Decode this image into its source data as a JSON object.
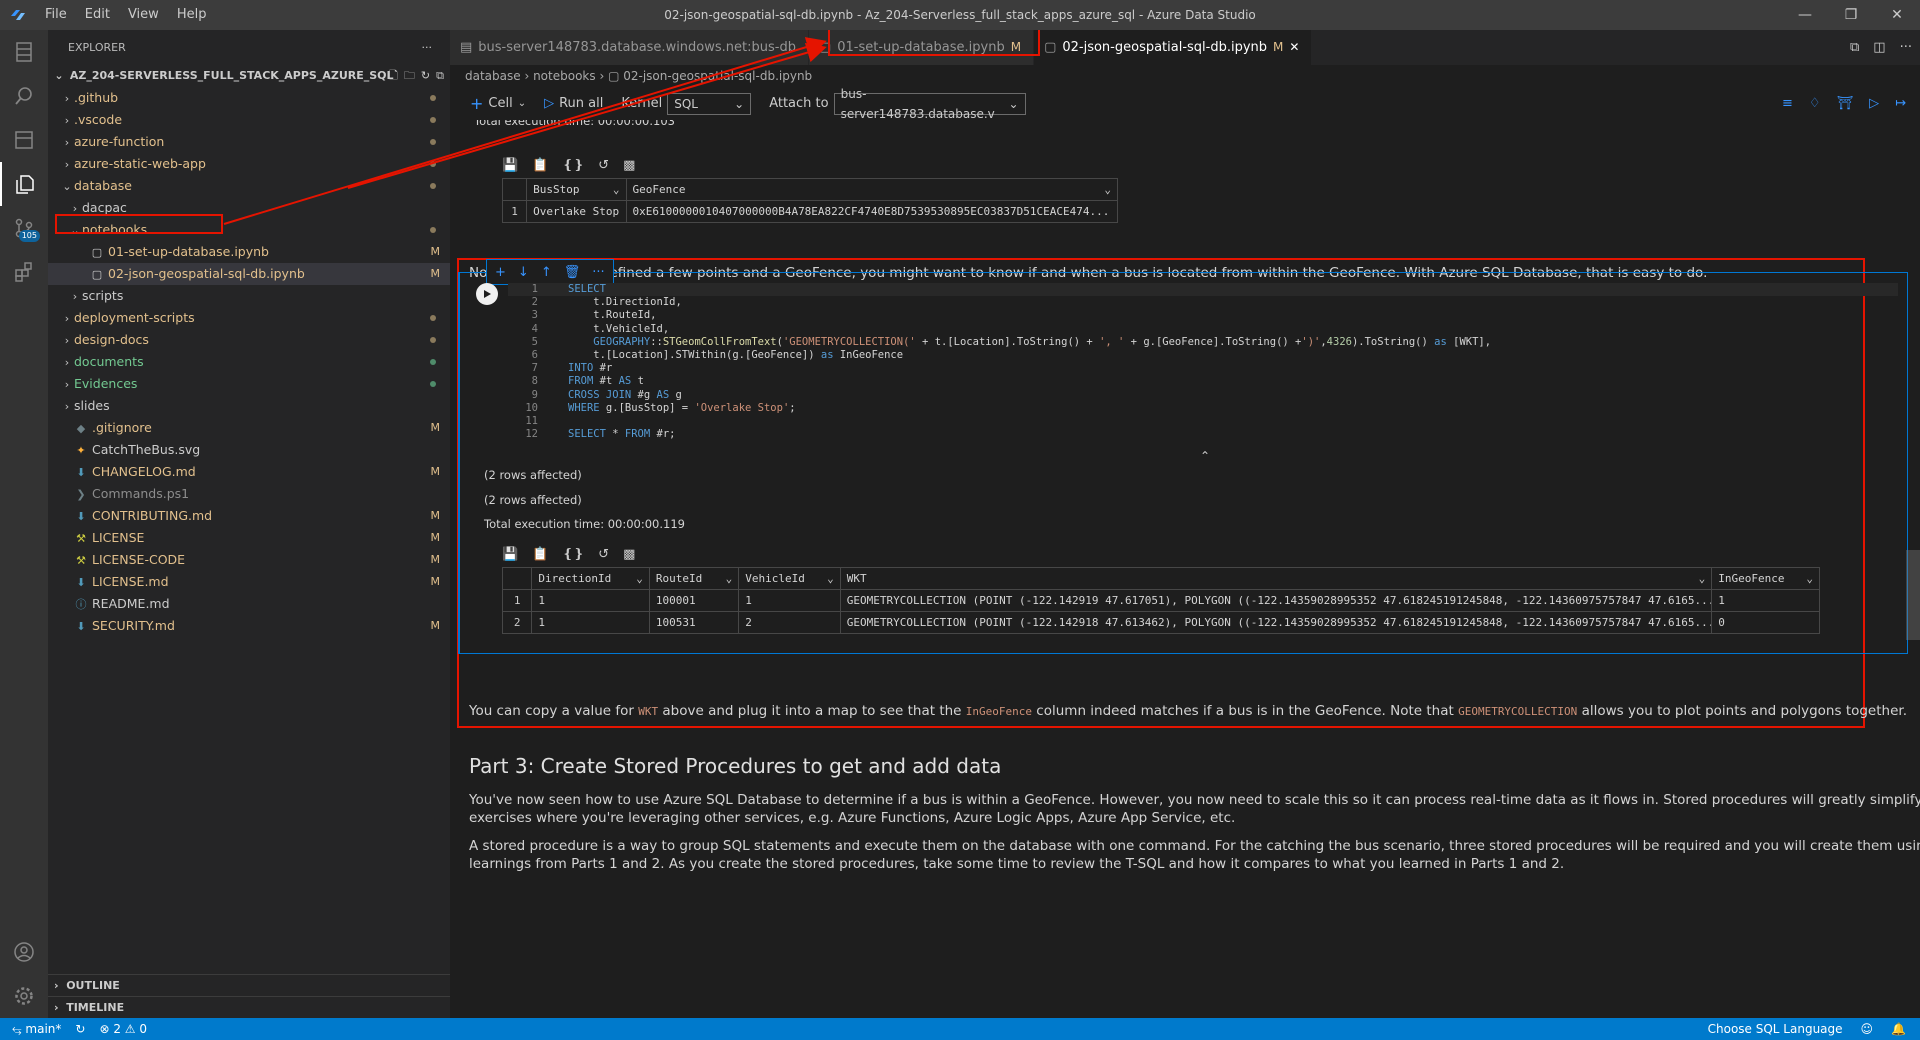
{
  "window": {
    "title": "02-json-geospatial-sql-db.ipynb - Az_204-Serverless_full_stack_apps_azure_sql - Azure Data Studio",
    "menu": [
      "File",
      "Edit",
      "View",
      "Help"
    ]
  },
  "activity": {
    "scm_badge": "105"
  },
  "explorer": {
    "header": "EXPLORER",
    "root": "AZ_204-SERVERLESS_FULL_STACK_APPS_AZURE_SQL",
    "items": [
      {
        "label": ".github",
        "type": "folder",
        "state": "collapsed",
        "indent": 0,
        "status": "dot-mod"
      },
      {
        "label": ".vscode",
        "type": "folder",
        "state": "collapsed",
        "indent": 0,
        "status": "dot-mod"
      },
      {
        "label": "azure-function",
        "type": "folder",
        "state": "collapsed",
        "indent": 0,
        "status": "dot-mod"
      },
      {
        "label": "azure-static-web-app",
        "type": "folder",
        "state": "collapsed",
        "indent": 0,
        "status": "dot-mod"
      },
      {
        "label": "database",
        "type": "folder",
        "state": "expanded",
        "indent": 0,
        "status": "dot-mod"
      },
      {
        "label": "dacpac",
        "type": "folder",
        "state": "collapsed",
        "indent": 1,
        "status": ""
      },
      {
        "label": "notebooks",
        "type": "folder",
        "state": "expanded",
        "indent": 1,
        "status": "dot-mod"
      },
      {
        "label": "01-set-up-database.ipynb",
        "type": "notebook",
        "state": "",
        "indent": 2,
        "status": "M"
      },
      {
        "label": "02-json-geospatial-sql-db.ipynb",
        "type": "notebook",
        "state": "",
        "indent": 2,
        "status": "M",
        "selected": true
      },
      {
        "label": "scripts",
        "type": "folder",
        "state": "collapsed",
        "indent": 1,
        "status": ""
      },
      {
        "label": "deployment-scripts",
        "type": "folder",
        "state": "collapsed",
        "indent": 0,
        "status": "dot-mod"
      },
      {
        "label": "design-docs",
        "type": "folder",
        "state": "collapsed",
        "indent": 0,
        "status": "dot-mod"
      },
      {
        "label": "documents",
        "type": "folder",
        "state": "collapsed",
        "indent": 0,
        "status": "dot-new"
      },
      {
        "label": "Evidences",
        "type": "folder",
        "state": "collapsed",
        "indent": 0,
        "status": "dot-new"
      },
      {
        "label": "slides",
        "type": "folder",
        "state": "collapsed",
        "indent": 0,
        "status": ""
      },
      {
        "label": ".gitignore",
        "type": "gitignore",
        "state": "",
        "indent": 0,
        "status": "M"
      },
      {
        "label": "CatchTheBus.svg",
        "type": "svg",
        "state": "",
        "indent": 0,
        "status": ""
      },
      {
        "label": "CHANGELOG.md",
        "type": "markdown",
        "state": "",
        "indent": 0,
        "status": "M"
      },
      {
        "label": "Commands.ps1",
        "type": "powershell",
        "state": "",
        "indent": 0,
        "status": ""
      },
      {
        "label": "CONTRIBUTING.md",
        "type": "markdown",
        "state": "",
        "indent": 0,
        "status": "M"
      },
      {
        "label": "LICENSE",
        "type": "license",
        "state": "",
        "indent": 0,
        "status": "M"
      },
      {
        "label": "LICENSE-CODE",
        "type": "license",
        "state": "",
        "indent": 0,
        "status": "M"
      },
      {
        "label": "LICENSE.md",
        "type": "markdown",
        "state": "",
        "indent": 0,
        "status": "M"
      },
      {
        "label": "README.md",
        "type": "info",
        "state": "",
        "indent": 0,
        "status": ""
      },
      {
        "label": "SECURITY.md",
        "type": "markdown",
        "state": "",
        "indent": 0,
        "status": "M"
      }
    ],
    "outline": "OUTLINE",
    "timeline": "TIMELINE"
  },
  "tabs": [
    {
      "label": "bus-server148783.database.windows.net:bus-db",
      "modified": ""
    },
    {
      "label": "01-set-up-database.ipynb",
      "modified": "M"
    },
    {
      "label": "02-json-geospatial-sql-db.ipynb",
      "modified": "M",
      "active": true
    }
  ],
  "breadcrumb": [
    "database",
    "notebooks",
    "02-json-geospatial-sql-db.ipynb"
  ],
  "toolbar": {
    "cell": "Cell",
    "run_all": "Run all",
    "kernel_label": "Kernel",
    "kernel_value": "SQL",
    "attach_label": "Attach to",
    "attach_value": "bus-server148783.database.v"
  },
  "prev_output": {
    "exec_time": "Total execution time: 00:00:00.103",
    "columns": [
      "BusStop",
      "GeoFence"
    ],
    "rows": [
      [
        "1",
        "Overlake Stop",
        "0xE6100000010407000000B4A78EA822CF4740E8D7539530895EC03837D51CEACE474..."
      ]
    ]
  },
  "md1": "Now that you have defined a few points and a GeoFence, you might want to know if and when a bus is located from within the GeoFence. With Azure SQL Database, that is easy to do.",
  "code_lines": [
    [
      [
        "kw",
        "SELECT"
      ]
    ],
    [
      [
        "id",
        "    t.DirectionId,"
      ]
    ],
    [
      [
        "id",
        "    t.RouteId,"
      ]
    ],
    [
      [
        "id",
        "    t.VehicleId,"
      ]
    ],
    [
      [
        "kw",
        "    GEOGRAPHY"
      ],
      [
        "id",
        "::"
      ],
      [
        "fn",
        "STGeomCollFromText"
      ],
      [
        "id",
        "("
      ],
      [
        "str",
        "'GEOMETRYCOLLECTION('"
      ],
      [
        "id",
        " + t.[Location].ToString() + "
      ],
      [
        "str",
        "', '"
      ],
      [
        "id",
        " + g.[GeoFence].ToString() +"
      ],
      [
        "str",
        "')'"
      ],
      [
        "id",
        ","
      ],
      [
        "num",
        "4326"
      ],
      [
        "id",
        ").ToString() "
      ],
      [
        "kw",
        "as"
      ],
      [
        "id",
        " [WKT],"
      ]
    ],
    [
      [
        "id",
        "    t.[Location].STWithin(g.[GeoFence]) "
      ],
      [
        "kw",
        "as"
      ],
      [
        "id",
        " InGeoFence"
      ]
    ],
    [
      [
        "kw",
        "INTO"
      ],
      [
        "id",
        " #r"
      ]
    ],
    [
      [
        "kw",
        "FROM"
      ],
      [
        "id",
        " #t "
      ],
      [
        "kw",
        "AS"
      ],
      [
        "id",
        " t"
      ]
    ],
    [
      [
        "kw",
        "CROSS JOIN"
      ],
      [
        "id",
        " #g "
      ],
      [
        "kw",
        "AS"
      ],
      [
        "id",
        " g"
      ]
    ],
    [
      [
        "kw",
        "WHERE"
      ],
      [
        "id",
        " g.[BusStop] = "
      ],
      [
        "str",
        "'Overlake Stop'"
      ],
      [
        "id",
        ";"
      ]
    ],
    [
      [
        "id",
        ""
      ]
    ],
    [
      [
        "kw",
        "SELECT"
      ],
      [
        "id",
        " * "
      ],
      [
        "kw",
        "FROM"
      ],
      [
        "id",
        " #r;"
      ]
    ]
  ],
  "output": {
    "msg1": "(2 rows affected)",
    "msg2": "(2 rows affected)",
    "exec_time": "Total execution time: 00:00:00.119",
    "columns": [
      "DirectionId",
      "RouteId",
      "VehicleId",
      "WKT",
      "InGeoFence"
    ],
    "rows": [
      [
        "1",
        "1",
        "100001",
        "1",
        "GEOMETRYCOLLECTION (POINT (-122.142919 47.617051), POLYGON ((-122.14359028995352 47.618245191245848, -122.14360975757847 47.6165...",
        "1"
      ],
      [
        "2",
        "1",
        "100531",
        "2",
        "GEOMETRYCOLLECTION (POINT (-122.142918 47.613462), POLYGON ((-122.14359028995352 47.618245191245848, -122.14360975757847 47.6165...",
        "0"
      ]
    ]
  },
  "md2": {
    "p1": "You can copy a value for ",
    "c1": "WKT",
    "p2": " above and plug it into a map to see that the ",
    "c2": "InGeoFence",
    "p3": " column indeed matches if a bus is in the GeoFence. Note that ",
    "c3": "GEOMETRYCOLLECTION",
    "p4": " allows you to plot points and polygons together."
  },
  "part3": {
    "heading": "Part 3: Create Stored Procedures to get and add data",
    "para1a": "You've now seen how to use Azure SQL Database to determine if a bus is within a GeoFence. However, you now need to scale this so it can process real-time data as it flows in. Stored procedures will greatly simplify this in future",
    "para1b": "exercises where you're leveraging other services, e.g. Azure Functions, Azure Logic Apps, Azure App Service, etc.",
    "para2a": "A stored procedure is a way to group SQL statements and execute them on the database with one command. For the catching the bus scenario, three stored procedures will be required and you will create them using your",
    "para2b": "learnings from Parts 1 and 2. As you create the stored procedures, take some time to review the T-SQL and how it compares to what you learned in Parts 1 and 2."
  },
  "status": {
    "branch": "main*",
    "errors": "2",
    "warnings": "0",
    "language": "Choose SQL Language"
  },
  "colors": {
    "accent": "#007acc",
    "highlight_box": "#e51400",
    "modified": "#e2c08d",
    "untracked": "#73c991"
  }
}
